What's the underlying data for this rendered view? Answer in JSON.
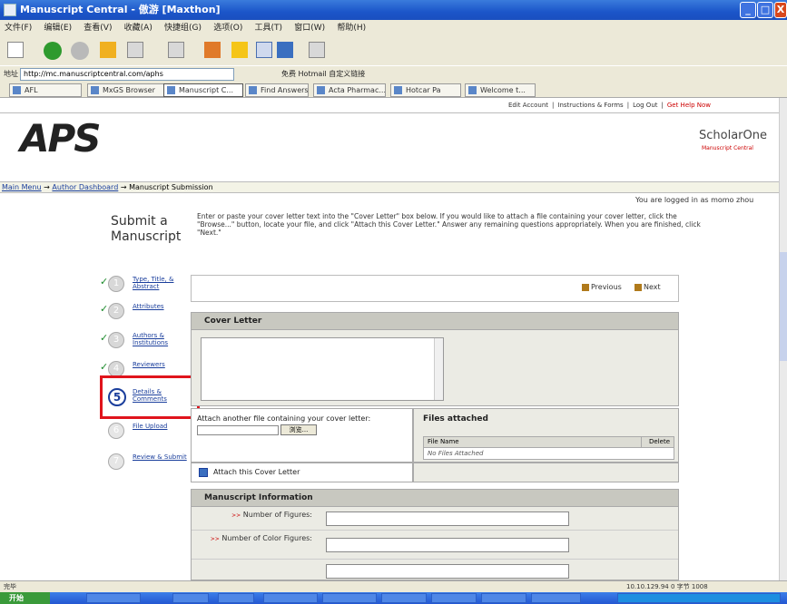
{
  "window": {
    "title": "Manuscript Central - 傲游 [Maxthon]",
    "min": "_",
    "max": "□",
    "close": "X"
  },
  "menu": [
    "文件(F)",
    "编辑(E)",
    "查看(V)",
    "收藏(A)",
    "快捷组(G)",
    "选项(O)",
    "工具(T)",
    "窗口(W)",
    "帮助(H)"
  ],
  "address": {
    "label": "地址",
    "url": "http://mc.manuscriptcentral.com/aphs",
    "links": "免费 Hotmail   自定义链接"
  },
  "tabs": [
    "AFL",
    "MxGS Browser",
    "Manuscript C...",
    "Find Answers",
    "Acta Pharmac...",
    "Hotcar Pa",
    "Welcome t..."
  ],
  "page": {
    "top_links": {
      "edit_account": "Edit Account",
      "instructions": "Instructions & Forms",
      "logout": "Log Out",
      "help": "Get Help Now",
      "sep": "|"
    },
    "logo": "APS",
    "scholarone": "ScholarOne",
    "scholarone_sub": "Manuscript Central",
    "breadcrumb": {
      "main_menu": "Main Menu",
      "arrow": "→",
      "author_dashboard": "Author Dashboard",
      "current": "Manuscript Submission"
    },
    "logged_in": "You are logged in as momo zhou",
    "submit_title": "Submit a Manuscript",
    "instructions": "Enter or paste your cover letter text into the \"Cover Letter\" box below. If you would like to attach a file containing your cover letter, click the \"Browse...\" button, locate your file, and click \"Attach this Cover Letter.\" Answer any remaining questions appropriately. When you are finished, click \"Next.\"",
    "steps": [
      {
        "num": "1",
        "label": "Type, Title, & Abstract",
        "done": true
      },
      {
        "num": "2",
        "label": "Attributes",
        "done": true
      },
      {
        "num": "3",
        "label": "Authors & Institutions",
        "done": true
      },
      {
        "num": "4",
        "label": "Reviewers",
        "done": true
      },
      {
        "num": "5",
        "label": "Details & Comments",
        "done": false
      },
      {
        "num": "6",
        "label": "File Upload",
        "done": false
      },
      {
        "num": "7",
        "label": "Review & Submit",
        "done": false
      }
    ],
    "check": "✓",
    "previous": "Previous",
    "next": "Next",
    "cover_letter_heading": "Cover Letter",
    "attach_prompt": "Attach another file containing your cover letter:",
    "browse": "浏览...",
    "files_attached": "Files attached",
    "file_name_col": "File Name",
    "delete_col": "Delete",
    "no_files": "No Files Attached",
    "attach_cover_letter": "Attach this Cover Letter",
    "manuscript_info_heading": "Manuscript Information",
    "req_mark": ">>",
    "fields": [
      "Number of Figures:",
      "Number of Color Figures:"
    ]
  },
  "status": {
    "left": "完毕",
    "right": "10.10.129.94    0 字节    1008"
  },
  "taskbar": {
    "start": "开始"
  }
}
